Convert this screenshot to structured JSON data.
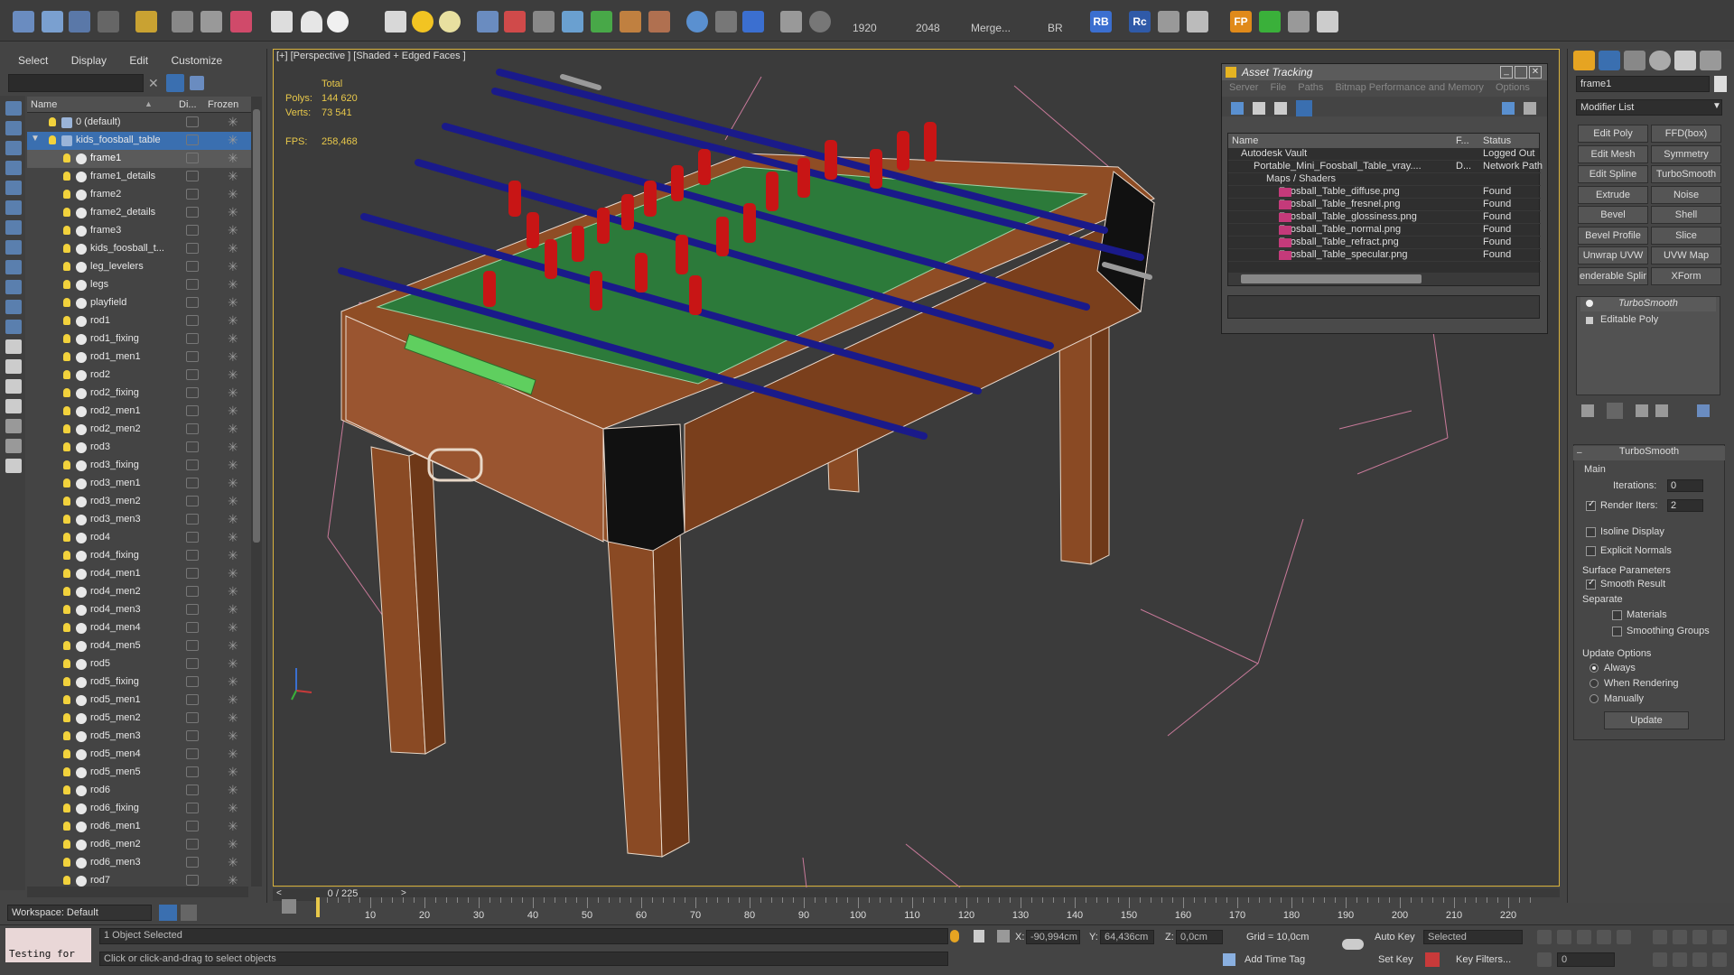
{
  "toolbar": {
    "render_width": "1920",
    "render_height": "2048",
    "merge_label": "Merge...",
    "br_label": "BR",
    "rb_label": "RB",
    "rc_label": "Rc",
    "fp_label": "FP"
  },
  "explorer": {
    "menu": [
      "Select",
      "Display",
      "Edit",
      "Customize"
    ],
    "headers": {
      "name": "Name",
      "display": "Di...",
      "frozen": "Frozen"
    },
    "rows": [
      {
        "name": "0 (default)",
        "level": 0,
        "layer": true
      },
      {
        "name": "kids_foosball_table",
        "level": 0,
        "layer": true,
        "selected": true
      },
      {
        "name": "frame1",
        "level": 1,
        "highlight": true
      },
      {
        "name": "frame1_details",
        "level": 1
      },
      {
        "name": "frame2",
        "level": 1
      },
      {
        "name": "frame2_details",
        "level": 1
      },
      {
        "name": "frame3",
        "level": 1
      },
      {
        "name": "kids_foosball_t...",
        "level": 1
      },
      {
        "name": "leg_levelers",
        "level": 1
      },
      {
        "name": "legs",
        "level": 1
      },
      {
        "name": "playfield",
        "level": 1
      },
      {
        "name": "rod1",
        "level": 1
      },
      {
        "name": "rod1_fixing",
        "level": 1
      },
      {
        "name": "rod1_men1",
        "level": 1
      },
      {
        "name": "rod2",
        "level": 1
      },
      {
        "name": "rod2_fixing",
        "level": 1
      },
      {
        "name": "rod2_men1",
        "level": 1
      },
      {
        "name": "rod2_men2",
        "level": 1
      },
      {
        "name": "rod3",
        "level": 1
      },
      {
        "name": "rod3_fixing",
        "level": 1
      },
      {
        "name": "rod3_men1",
        "level": 1
      },
      {
        "name": "rod3_men2",
        "level": 1
      },
      {
        "name": "rod3_men3",
        "level": 1
      },
      {
        "name": "rod4",
        "level": 1
      },
      {
        "name": "rod4_fixing",
        "level": 1
      },
      {
        "name": "rod4_men1",
        "level": 1
      },
      {
        "name": "rod4_men2",
        "level": 1
      },
      {
        "name": "rod4_men3",
        "level": 1
      },
      {
        "name": "rod4_men4",
        "level": 1
      },
      {
        "name": "rod4_men5",
        "level": 1
      },
      {
        "name": "rod5",
        "level": 1
      },
      {
        "name": "rod5_fixing",
        "level": 1
      },
      {
        "name": "rod5_men1",
        "level": 1
      },
      {
        "name": "rod5_men2",
        "level": 1
      },
      {
        "name": "rod5_men3",
        "level": 1
      },
      {
        "name": "rod5_men4",
        "level": 1
      },
      {
        "name": "rod5_men5",
        "level": 1
      },
      {
        "name": "rod6",
        "level": 1
      },
      {
        "name": "rod6_fixing",
        "level": 1
      },
      {
        "name": "rod6_men1",
        "level": 1
      },
      {
        "name": "rod6_men2",
        "level": 1
      },
      {
        "name": "rod6_men3",
        "level": 1
      },
      {
        "name": "rod7",
        "level": 1
      }
    ],
    "workspace": "Workspace: Default"
  },
  "viewport": {
    "label": "[+] [Perspective ] [Shaded + Edged Faces ]",
    "stats_total": "Total",
    "polys_label": "Polys:",
    "polys_value": "144 620",
    "verts_label": "Verts:",
    "verts_value": "73 541",
    "fps_label": "FPS:",
    "fps_value": "258,468"
  },
  "asset_tracking": {
    "title": "Asset Tracking",
    "menu": [
      "Server",
      "File",
      "Paths",
      "Bitmap Performance and Memory",
      "Options"
    ],
    "headers": {
      "name": "Name",
      "f": "F...",
      "status": "Status"
    },
    "rows": [
      {
        "name": "Autodesk Vault",
        "f": "",
        "status": "Logged Out",
        "indent": 1
      },
      {
        "name": "Portable_Mini_Foosball_Table_vray....",
        "f": "D...",
        "status": "Network Path",
        "indent": 2
      },
      {
        "name": "Maps / Shaders",
        "f": "",
        "status": "",
        "indent": 3
      },
      {
        "name": "Foosball_Table_diffuse.png",
        "f": "",
        "status": "Found",
        "indent": 4,
        "png": true
      },
      {
        "name": "Foosball_Table_fresnel.png",
        "f": "",
        "status": "Found",
        "indent": 4,
        "png": true
      },
      {
        "name": "Foosball_Table_glossiness.png",
        "f": "",
        "status": "Found",
        "indent": 4,
        "png": true
      },
      {
        "name": "Foosball_Table_normal.png",
        "f": "",
        "status": "Found",
        "indent": 4,
        "png": true
      },
      {
        "name": "Foosball_Table_refract.png",
        "f": "",
        "status": "Found",
        "indent": 4,
        "png": true
      },
      {
        "name": "Foosball_Table_specular.png",
        "f": "",
        "status": "Found",
        "indent": 4,
        "png": true
      }
    ]
  },
  "command_panel": {
    "object_name": "frame1",
    "modifier_list": "Modifier List",
    "buttons": [
      [
        "Edit Poly",
        "FFD(box)"
      ],
      [
        "Edit Mesh",
        "Symmetry"
      ],
      [
        "Edit Spline",
        "TurboSmooth"
      ],
      [
        "Extrude",
        "Noise"
      ],
      [
        "Bevel",
        "Shell"
      ],
      [
        "Bevel Profile",
        "Slice"
      ],
      [
        "Unwrap UVW",
        "UVW Map"
      ],
      [
        "enderable Splir",
        "XForm"
      ]
    ],
    "stack": [
      "TurboSmooth",
      "Editable Poly"
    ],
    "rollout_title": "TurboSmooth",
    "main_label": "Main",
    "iterations_label": "Iterations:",
    "iterations_value": "0",
    "render_iters_label": "Render Iters:",
    "render_iters_value": "2",
    "isoline_label": "Isoline Display",
    "explicit_label": "Explicit Normals",
    "surface_label": "Surface Parameters",
    "smooth_label": "Smooth Result",
    "separate_label": "Separate",
    "materials_label": "Materials",
    "smoothing_label": "Smoothing Groups",
    "update_options_label": "Update Options",
    "always_label": "Always",
    "when_rendering_label": "When Rendering",
    "manually_label": "Manually",
    "update_button": "Update"
  },
  "timeline": {
    "slider": "0 / 225",
    "ticks": [
      "10",
      "20",
      "30",
      "40",
      "50",
      "60",
      "70",
      "80",
      "90",
      "100",
      "110",
      "120",
      "130",
      "140",
      "150",
      "160",
      "170",
      "180",
      "190",
      "200",
      "210",
      "220"
    ]
  },
  "status": {
    "testing": "Testing for",
    "selected": "1 Object Selected",
    "prompt": "Click or click-and-drag to select objects",
    "x_label": "X:",
    "x_value": "-90,994cm",
    "y_label": "Y:",
    "y_value": "64,436cm",
    "z_label": "Z:",
    "z_value": "0,0cm",
    "grid": "Grid = 10,0cm",
    "add_time_tag": "Add Time Tag",
    "auto_key": "Auto Key",
    "set_key": "Set Key",
    "selected_dropdown": "Selected",
    "key_filters": "Key Filters...",
    "frame_value": "0"
  },
  "colors": {
    "accent": "#3a6fb0",
    "viewport_border": "#d8b23d",
    "stats_text": "#e8c84a",
    "table_wood": "#8a4a22",
    "field_green": "#2f7a3e",
    "players_red": "#c81515",
    "rods_blue": "#1a1a8a"
  }
}
